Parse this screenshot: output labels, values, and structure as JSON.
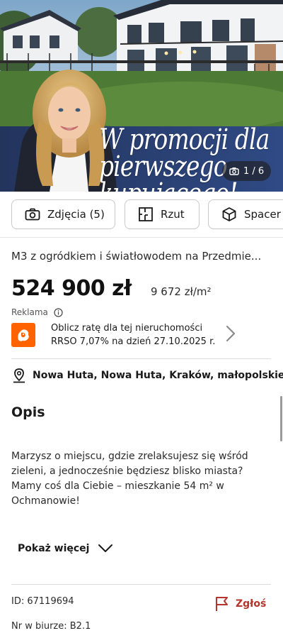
{
  "hero": {
    "promo_line1": "W promocji dla",
    "promo_line2": "pierwszego",
    "promo_line3": "kupującego!",
    "photo_counter": "1 / 6"
  },
  "actions": [
    {
      "label": "Zdjęcia (5)",
      "icon": "camera-icon"
    },
    {
      "label": "Rzut",
      "icon": "floorplan-icon"
    },
    {
      "label": "Spacer w",
      "icon": "cube-icon"
    }
  ],
  "listing": {
    "title": "M3 z ogródkiem i światłowodem na Przedmie...",
    "price": "524 900 zł",
    "price_per_m2": "9 672 zł/m²",
    "location": "Nowa Huta, Nowa Huta, Kraków, małopolskie",
    "id": "ID: 67119694",
    "office_no": "Nr w biurze: B2.1"
  },
  "ad": {
    "label": "Reklama",
    "line1": "Oblicz ratę dla tej nieruchomości",
    "line2": "RRSO 7,07% na dzień 27.10.2025 r.",
    "brand_color": "#ff6200"
  },
  "description": {
    "heading": "Opis",
    "text": "Marzysz o miejscu, gdzie zrelaksujesz się wśród zieleni, a jednocześnie będziesz blisko miasta? Mamy coś dla Ciebie – mieszkanie 54 m² w Ochmanowie!",
    "show_more": "Pokaż więcej"
  },
  "report": {
    "label": "Zgłoś",
    "color": "#b5342c"
  }
}
